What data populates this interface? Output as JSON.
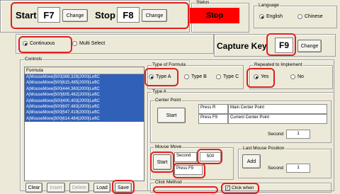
{
  "hotkeys": {
    "start_label": "Start",
    "start_key": "F7",
    "start_change": "Change",
    "stop_label": "Stop",
    "stop_key": "F8",
    "stop_change": "Change"
  },
  "status": {
    "legend": "Status",
    "value": "Stop"
  },
  "language": {
    "legend": "Language",
    "english": "English",
    "chinese": "Chinese",
    "selected": "English"
  },
  "mode": {
    "continuous": "Continuous",
    "multi_select": "Multi Select",
    "selected": "Continuous"
  },
  "capture": {
    "label": "Capture Key",
    "key": "F9",
    "change": "Change"
  },
  "controls": {
    "legend": "Controls"
  },
  "formula_list": {
    "header": "Formula",
    "items": [
      "A|MouseMove|500|369,328|2000|LeftC",
      "A|MouseMove|500|615,485|2000|LeftC",
      "A|MouseMove|500|444,360|2000|LeftC",
      "A|MouseMove|500|605,482|2000|LeftC",
      "A|MouseMove|500|400,403|2000|LeftC",
      "A|MouseMove|500|607,483|2000|LeftC",
      "A|MouseMove|500|547,419|2000|LeftC",
      "A|MouseMove|500|614,484|2000|LeftC"
    ]
  },
  "bottom_buttons": {
    "clear": "Clear",
    "insert": "Insert",
    "delete": "Delete",
    "load": "Load",
    "save": "Save"
  },
  "formula_type": {
    "legend": "Type of Formula",
    "a": "Type A",
    "b": "Type B",
    "c": "Type C",
    "selected": "Type A"
  },
  "repeated": {
    "legend": "Repeated to Implement",
    "yes": "Yes",
    "no": "No",
    "selected": "Yes"
  },
  "type_a": {
    "legend": "Type A"
  },
  "center_point": {
    "legend": "Center Point",
    "start": "Start",
    "press_r": "Press R",
    "press_f9": "Press F9",
    "main_label": "Main Center Point",
    "current_label": "Current Center Point",
    "second_label": "Second",
    "second_value": "1"
  },
  "mouse_move": {
    "legend": "Mouse Move",
    "start": "Start",
    "second_label": "Second",
    "second_value": "500",
    "press_f9": "Press F9"
  },
  "last_pos": {
    "legend": "Last Mouse Position",
    "add": "Add",
    "second_label": "Second",
    "second_value": "1"
  },
  "click_method": {
    "legend": "Click Method",
    "click_when": "Click when"
  },
  "colors": {
    "highlight_red": "#e02020",
    "status_red": "#ff0000",
    "list_blue": "#3060b8"
  }
}
